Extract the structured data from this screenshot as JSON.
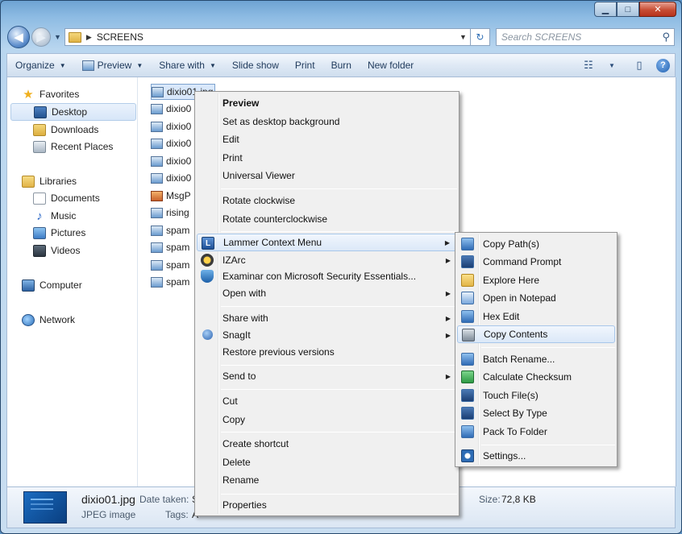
{
  "window": {
    "caption": {
      "minimize": "▁",
      "maximize": "□",
      "close": "✕"
    }
  },
  "address": {
    "back_glyph": "◀",
    "forward_glyph": "▶",
    "breadcrumb_sep": "▶",
    "path": "SCREENS",
    "dropdown": "▼",
    "refresh_glyph": "↻"
  },
  "search": {
    "placeholder": "Search SCREENS",
    "icon": "search-icon",
    "glyph": "⚲"
  },
  "toolbar": {
    "organize": "Organize",
    "preview": "Preview",
    "share_with": "Share with",
    "slide_show": "Slide show",
    "print": "Print",
    "burn": "Burn",
    "new_folder": "New folder",
    "dd": "▼",
    "views_glyph": "☷",
    "pane_glyph": "▯",
    "help": "?"
  },
  "sidebar": {
    "star_glyph": "★",
    "note_glyph": "♪",
    "items": [
      {
        "label": "Favorites"
      },
      {
        "label": "Desktop"
      },
      {
        "label": "Downloads"
      },
      {
        "label": "Recent Places"
      },
      {
        "label": "Libraries"
      },
      {
        "label": "Documents"
      },
      {
        "label": "Music"
      },
      {
        "label": "Pictures"
      },
      {
        "label": "Videos"
      },
      {
        "label": "Computer"
      },
      {
        "label": "Network"
      }
    ]
  },
  "files": [
    {
      "name": "dixio01.jpg"
    },
    {
      "name": "dixio0"
    },
    {
      "name": "dixio0"
    },
    {
      "name": "dixio0"
    },
    {
      "name": "dixio0"
    },
    {
      "name": "dixio0"
    },
    {
      "name": "MsgP"
    },
    {
      "name": "rising"
    },
    {
      "name": "spam"
    },
    {
      "name": "spam"
    },
    {
      "name": "spam"
    },
    {
      "name": "spam"
    }
  ],
  "context_menu": {
    "items": [
      {
        "label": "Preview"
      },
      {
        "label": "Set as desktop background"
      },
      {
        "label": "Edit"
      },
      {
        "label": "Print"
      },
      {
        "label": "Universal Viewer"
      },
      {
        "label": "Rotate clockwise"
      },
      {
        "label": "Rotate counterclockwise"
      },
      {
        "label": "Lammer Context Menu"
      },
      {
        "label": "IZArc"
      },
      {
        "label": "Examinar con Microsoft Security Essentials..."
      },
      {
        "label": "Open with"
      },
      {
        "label": "Share with"
      },
      {
        "label": "SnagIt"
      },
      {
        "label": "Restore previous versions"
      },
      {
        "label": "Send to"
      },
      {
        "label": "Cut"
      },
      {
        "label": "Copy"
      },
      {
        "label": "Create shortcut"
      },
      {
        "label": "Delete"
      },
      {
        "label": "Rename"
      },
      {
        "label": "Properties"
      }
    ],
    "submenu_arrow": "▶",
    "lammer_icon_text": "L"
  },
  "submenu": {
    "items": [
      {
        "label": "Copy Path(s)"
      },
      {
        "label": "Command Prompt"
      },
      {
        "label": "Explore Here"
      },
      {
        "label": "Open in Notepad"
      },
      {
        "label": "Hex Edit"
      },
      {
        "label": "Copy Contents"
      },
      {
        "label": "Batch Rename..."
      },
      {
        "label": "Calculate Checksum"
      },
      {
        "label": "Touch File(s)"
      },
      {
        "label": "Select By Type"
      },
      {
        "label": "Pack To Folder"
      },
      {
        "label": "Settings..."
      }
    ]
  },
  "details": {
    "file_name": "dixio01.jpg",
    "file_type": "JPEG image",
    "date_taken_label": "Date taken:",
    "date_taken_value": "S",
    "tags_label": "Tags:",
    "tags_value": "A",
    "size_label": "Size:",
    "size_value": "72,8 KB"
  }
}
